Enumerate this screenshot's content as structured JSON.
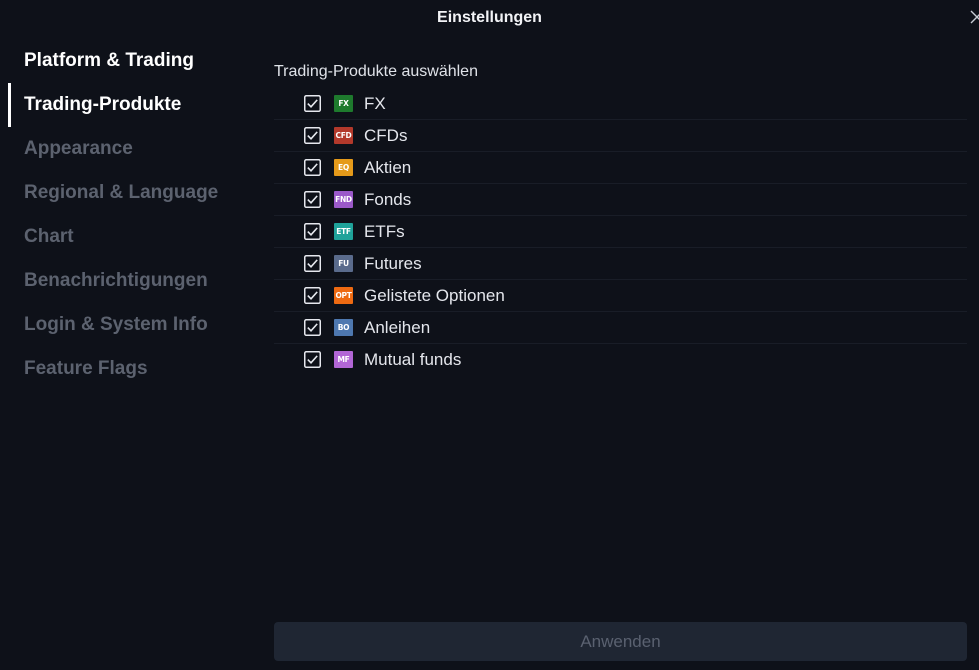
{
  "dialog": {
    "title": "Einstellungen"
  },
  "sidebar": {
    "items": [
      {
        "label": "Platform & Trading",
        "state": "section"
      },
      {
        "label": "Trading-Produkte",
        "state": "selected"
      },
      {
        "label": "Appearance",
        "state": "inactive"
      },
      {
        "label": "Regional & Language",
        "state": "inactive"
      },
      {
        "label": "Chart",
        "state": "inactive"
      },
      {
        "label": "Benachrichtigungen",
        "state": "inactive"
      },
      {
        "label": "Login & System Info",
        "state": "inactive"
      },
      {
        "label": "Feature Flags",
        "state": "inactive"
      }
    ]
  },
  "content": {
    "section_title": "Trading-Produkte auswählen",
    "products": [
      {
        "badge": "FX",
        "badge_color": "#1e7a2d",
        "label": "FX",
        "checked": true
      },
      {
        "badge": "CFD",
        "badge_color": "#b3392b",
        "label": "CFDs",
        "checked": true
      },
      {
        "badge": "EQ",
        "badge_color": "#e59a1a",
        "label": "Aktien",
        "checked": true
      },
      {
        "badge": "FND",
        "badge_color": "#9b59c9",
        "label": "Fonds",
        "checked": true
      },
      {
        "badge": "ETF",
        "badge_color": "#1fa39a",
        "label": "ETFs",
        "checked": true
      },
      {
        "badge": "FU",
        "badge_color": "#5a6b8c",
        "label": "Futures",
        "checked": true
      },
      {
        "badge": "OPT",
        "badge_color": "#ee6a12",
        "label": "Gelistete Optionen",
        "checked": true
      },
      {
        "badge": "BO",
        "badge_color": "#4e78b0",
        "label": "Anleihen",
        "checked": true
      },
      {
        "badge": "MF",
        "badge_color": "#b266d6",
        "label": "Mutual funds",
        "checked": true
      }
    ]
  },
  "footer": {
    "apply_label": "Anwenden",
    "apply_enabled": false
  }
}
